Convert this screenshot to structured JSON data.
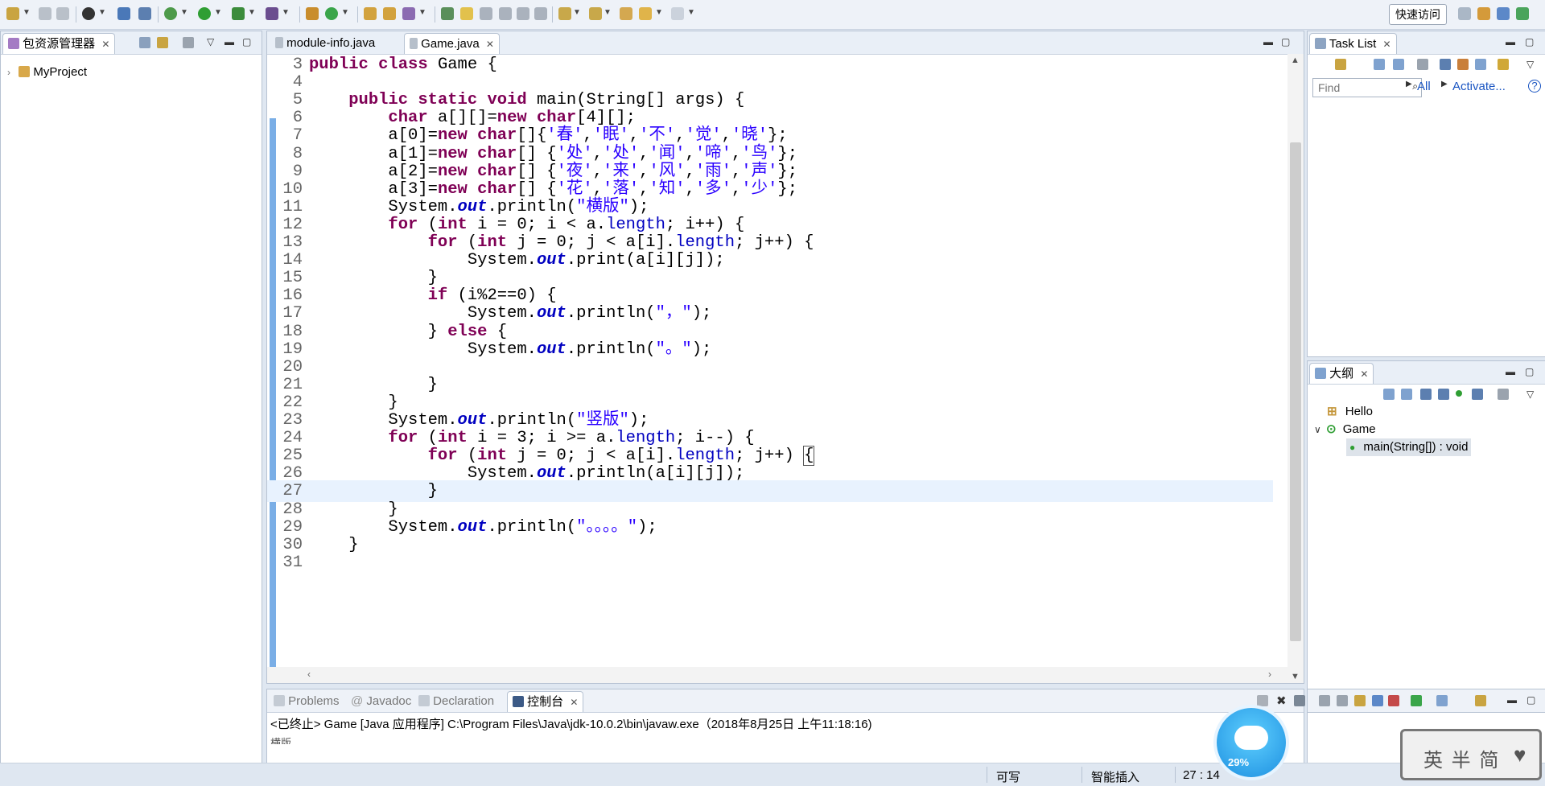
{
  "toolbar": {
    "quick_access_label": "快速访问"
  },
  "package_explorer": {
    "tab_label": "包资源管理器",
    "project": "MyProject"
  },
  "editor": {
    "tabs": [
      {
        "label": "module-info.java"
      },
      {
        "label": "Game.java"
      }
    ]
  },
  "code_lines": [
    {
      "n": "3",
      "html": "<span class=\"kw\">public</span> <span class=\"kw\">class</span> Game {"
    },
    {
      "n": "4",
      "html": ""
    },
    {
      "n": "5",
      "html": "    <span class=\"kw\">public</span> <span class=\"kw\">static</span> <span class=\"kw\">void</span> main(String[] args) {"
    },
    {
      "n": "6",
      "html": "        <span class=\"kw\">char</span> a[][]=<span class=\"kw\">new</span> <span class=\"kw\">char</span>[4][];"
    },
    {
      "n": "7",
      "html": "        a[0]=<span class=\"kw\">new</span> <span class=\"kw\">char</span>[]{<span class=\"str\">'春'</span>,<span class=\"str\">'眠'</span>,<span class=\"str\">'不'</span>,<span class=\"str\">'觉'</span>,<span class=\"str\">'晓'</span>};"
    },
    {
      "n": "8",
      "html": "        a[1]=<span class=\"kw\">new</span> <span class=\"kw\">char</span>[] {<span class=\"str\">'处'</span>,<span class=\"str\">'处'</span>,<span class=\"str\">'闻'</span>,<span class=\"str\">'啼'</span>,<span class=\"str\">'鸟'</span>};"
    },
    {
      "n": "9",
      "html": "        a[2]=<span class=\"kw\">new</span> <span class=\"kw\">char</span>[] {<span class=\"str\">'夜'</span>,<span class=\"str\">'来'</span>,<span class=\"str\">'风'</span>,<span class=\"str\">'雨'</span>,<span class=\"str\">'声'</span>};"
    },
    {
      "n": "10",
      "html": "        a[3]=<span class=\"kw\">new</span> <span class=\"kw\">char</span>[] {<span class=\"str\">'花'</span>,<span class=\"str\">'落'</span>,<span class=\"str\">'知'</span>,<span class=\"str\">'多'</span>,<span class=\"str\">'少'</span>};"
    },
    {
      "n": "11",
      "html": "        System.<span class=\"fld\">out</span>.println(<span class=\"str\">\"横版\"</span>);"
    },
    {
      "n": "12",
      "html": "        <span class=\"kw\">for</span> (<span class=\"kw\">int</span> i = 0; i &lt; a.<span class=\"fld2\">length</span>; i++) {"
    },
    {
      "n": "13",
      "html": "            <span class=\"kw\">for</span> (<span class=\"kw\">int</span> j = 0; j &lt; a[i].<span class=\"fld2\">length</span>; j++) {"
    },
    {
      "n": "14",
      "html": "                System.<span class=\"fld\">out</span>.print(a[i][j]);"
    },
    {
      "n": "15",
      "html": "            }"
    },
    {
      "n": "16",
      "html": "            <span class=\"kw\">if</span> (i%2==0) {"
    },
    {
      "n": "17",
      "html": "                System.<span class=\"fld\">out</span>.println(<span class=\"str\">\"，\"</span>);"
    },
    {
      "n": "18",
      "html": "            } <span class=\"kw\">else</span> {"
    },
    {
      "n": "19",
      "html": "                System.<span class=\"fld\">out</span>.println(<span class=\"str\">\"。\"</span>);"
    },
    {
      "n": "20",
      "html": ""
    },
    {
      "n": "21",
      "html": "            }"
    },
    {
      "n": "22",
      "html": "        }"
    },
    {
      "n": "23",
      "html": "        System.<span class=\"fld\">out</span>.println(<span class=\"str\">\"竖版\"</span>);"
    },
    {
      "n": "24",
      "html": "        <span class=\"kw\">for</span> (<span class=\"kw\">int</span> i = 3; i &gt;= a.<span class=\"fld2\">length</span>; i--) {"
    },
    {
      "n": "25",
      "html": "            <span class=\"kw\">for</span> (<span class=\"kw\">int</span> j = 0; j &lt; a[i].<span class=\"fld2\">length</span>; j++) <span style=\"outline:1px solid #555\">{</span>"
    },
    {
      "n": "26",
      "html": "                System.<span class=\"fld\">out</span>.println(a[i][j]);"
    },
    {
      "n": "27",
      "html": "            }"
    },
    {
      "n": "28",
      "html": "        }"
    },
    {
      "n": "29",
      "html": "        System.<span class=\"fld\">out</span>.println(<span class=\"str\">\"。。。。\"</span>);"
    },
    {
      "n": "30",
      "html": "    }"
    },
    {
      "n": "31",
      "html": ""
    }
  ],
  "task_list": {
    "tab_label": "Task List",
    "find_placeholder": "Find",
    "all_label": "All",
    "activate_label": "Activate..."
  },
  "outline": {
    "tab_label": "大纲",
    "items": [
      {
        "label": "Hello"
      },
      {
        "label": "Game"
      },
      {
        "label": "main(String[]) : void"
      }
    ]
  },
  "console": {
    "tabs": [
      {
        "label": "Problems"
      },
      {
        "label": "Javadoc"
      },
      {
        "label": "Declaration"
      },
      {
        "label": "控制台"
      }
    ],
    "terminated_line": "<已终止> Game [Java 应用程序] C:\\Program Files\\Java\\jdk-10.0.2\\bin\\javaw.exe（2018年8月25日 上午11:18:16)",
    "output_partial": "横版"
  },
  "status": {
    "writable": "可写",
    "insert_mode": "智能插入",
    "position": "27 : 14"
  },
  "widgets": {
    "cpu_percent": "29%",
    "ime_label": "英 半 简"
  },
  "colors": {
    "keyword": "#7f0055",
    "string": "#2a00ff",
    "field": "#0000c0"
  }
}
